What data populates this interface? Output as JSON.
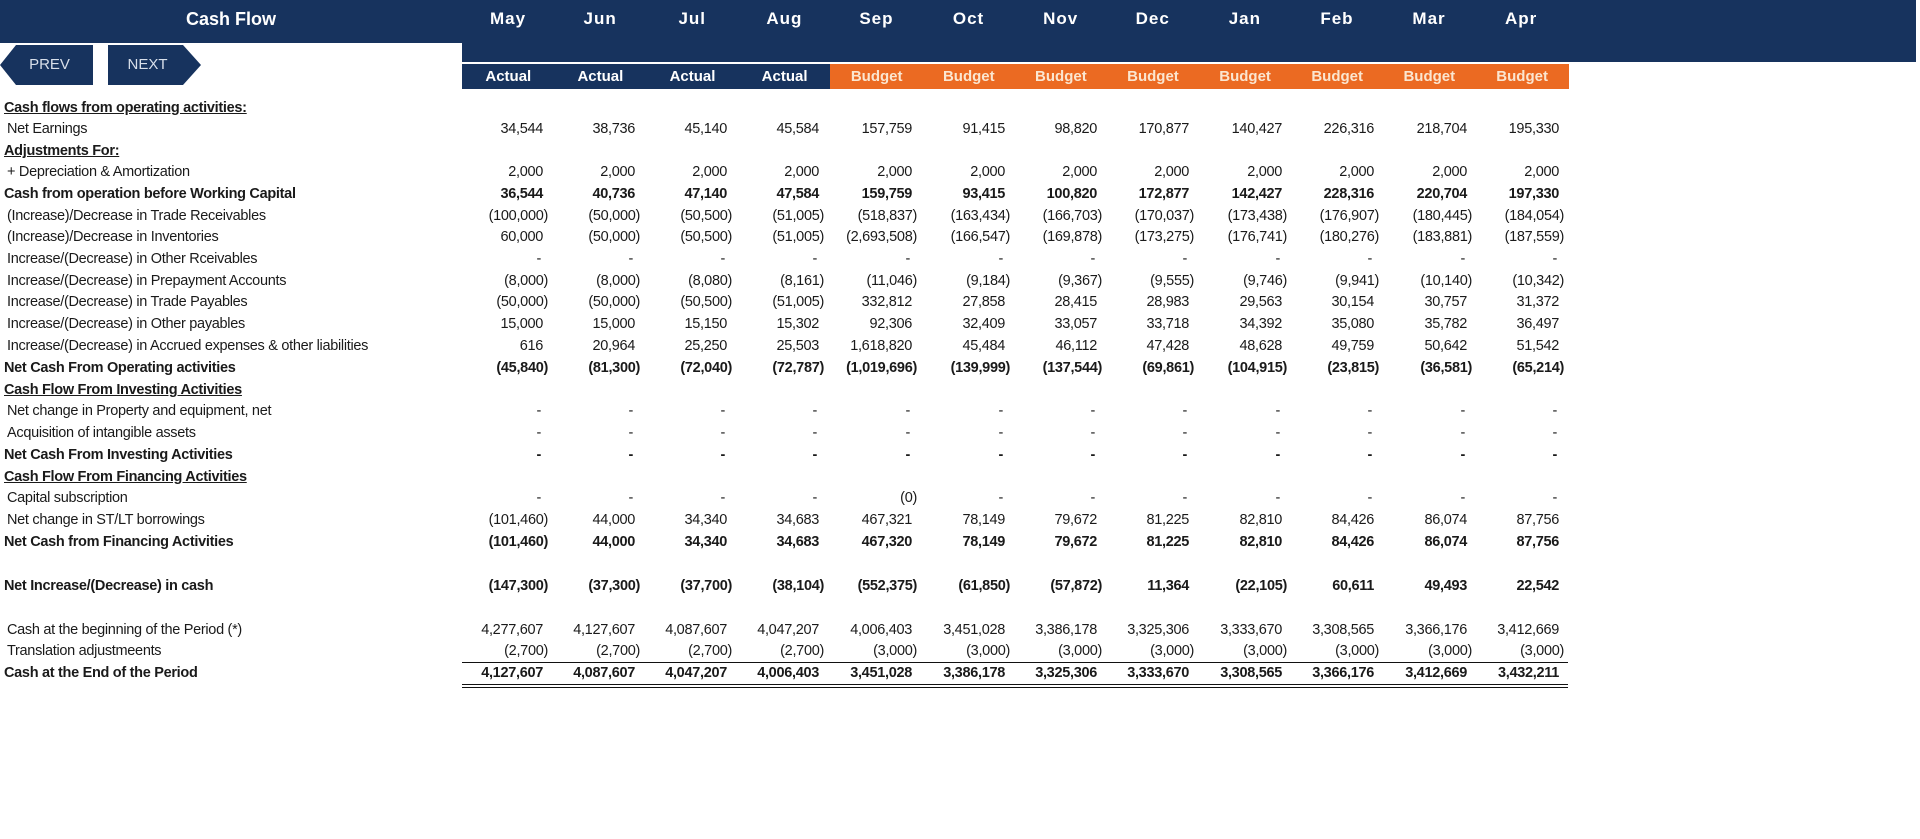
{
  "header": {
    "title": "Cash Flow",
    "prev_label": "PREV",
    "next_label": "NEXT",
    "months": [
      "May",
      "Jun",
      "Jul",
      "Aug",
      "Sep",
      "Oct",
      "Nov",
      "Dec",
      "Jan",
      "Feb",
      "Mar",
      "Apr"
    ],
    "types": [
      "Actual",
      "Actual",
      "Actual",
      "Actual",
      "Budget",
      "Budget",
      "Budget",
      "Budget",
      "Budget",
      "Budget",
      "Budget",
      "Budget"
    ]
  },
  "colors": {
    "navy": "#17335E",
    "budget_orange": "#EB6A22",
    "budget_text": "#FBE6D0"
  },
  "rows": [
    {
      "label": "Cash flows from operating activities:",
      "style": "section",
      "values": []
    },
    {
      "label": "Net Earnings",
      "style": "normal",
      "values": [
        "34,544",
        "38,736",
        "45,140",
        "45,584",
        "157,759",
        "91,415",
        "98,820",
        "170,877",
        "140,427",
        "226,316",
        "218,704",
        "195,330"
      ]
    },
    {
      "label": "Adjustments For:",
      "style": "section",
      "values": []
    },
    {
      "label": "+ Depreciation & Amortization",
      "style": "normal",
      "values": [
        "2,000",
        "2,000",
        "2,000",
        "2,000",
        "2,000",
        "2,000",
        "2,000",
        "2,000",
        "2,000",
        "2,000",
        "2,000",
        "2,000"
      ]
    },
    {
      "label": "Cash from operation before Working Capital",
      "style": "bold",
      "values": [
        "36,544",
        "40,736",
        "47,140",
        "47,584",
        "159,759",
        "93,415",
        "100,820",
        "172,877",
        "142,427",
        "228,316",
        "220,704",
        "197,330"
      ]
    },
    {
      "label": "(Increase)/Decrease in Trade Receivables",
      "style": "normal",
      "values": [
        "(100,000)",
        "(50,000)",
        "(50,500)",
        "(51,005)",
        "(518,837)",
        "(163,434)",
        "(166,703)",
        "(170,037)",
        "(173,438)",
        "(176,907)",
        "(180,445)",
        "(184,054)"
      ]
    },
    {
      "label": "(Increase)/Decrease in Inventories",
      "style": "normal",
      "values": [
        "60,000",
        "(50,000)",
        "(50,500)",
        "(51,005)",
        "(2,693,508)",
        "(166,547)",
        "(169,878)",
        "(173,275)",
        "(176,741)",
        "(180,276)",
        "(183,881)",
        "(187,559)"
      ]
    },
    {
      "label": "Increase/(Decrease) in Other Rceivables",
      "style": "normal",
      "values": [
        "-",
        "-",
        "-",
        "-",
        "-",
        "-",
        "-",
        "-",
        "-",
        "-",
        "-",
        "-"
      ]
    },
    {
      "label": "Increase/(Decrease) in Prepayment Accounts",
      "style": "normal",
      "values": [
        "(8,000)",
        "(8,000)",
        "(8,080)",
        "(8,161)",
        "(11,046)",
        "(9,184)",
        "(9,367)",
        "(9,555)",
        "(9,746)",
        "(9,941)",
        "(10,140)",
        "(10,342)"
      ]
    },
    {
      "label": "Increase/(Decrease) in Trade Payables",
      "style": "normal",
      "values": [
        "(50,000)",
        "(50,000)",
        "(50,500)",
        "(51,005)",
        "332,812",
        "27,858",
        "28,415",
        "28,983",
        "29,563",
        "30,154",
        "30,757",
        "31,372"
      ]
    },
    {
      "label": "Increase/(Decrease) in Other payables",
      "style": "normal",
      "values": [
        "15,000",
        "15,000",
        "15,150",
        "15,302",
        "92,306",
        "32,409",
        "33,057",
        "33,718",
        "34,392",
        "35,080",
        "35,782",
        "36,497"
      ]
    },
    {
      "label": "Increase/(Decrease) in Accrued expenses & other liabilities",
      "style": "normal",
      "values": [
        "616",
        "20,964",
        "25,250",
        "25,503",
        "1,618,820",
        "45,484",
        "46,112",
        "47,428",
        "48,628",
        "49,759",
        "50,642",
        "51,542"
      ]
    },
    {
      "label": "Net Cash From Operating activities",
      "style": "bold",
      "values": [
        "(45,840)",
        "(81,300)",
        "(72,040)",
        "(72,787)",
        "(1,019,696)",
        "(139,999)",
        "(137,544)",
        "(69,861)",
        "(104,915)",
        "(23,815)",
        "(36,581)",
        "(65,214)"
      ]
    },
    {
      "label": "Cash Flow From Investing Activities",
      "style": "section",
      "values": []
    },
    {
      "label": "Net change in Property and equipment, net",
      "style": "normal",
      "values": [
        "-",
        "-",
        "-",
        "-",
        "-",
        "-",
        "-",
        "-",
        "-",
        "-",
        "-",
        "-"
      ]
    },
    {
      "label": "Acquisition of intangible assets",
      "style": "normal",
      "values": [
        "-",
        "-",
        "-",
        "-",
        "-",
        "-",
        "-",
        "-",
        "-",
        "-",
        "-",
        "-"
      ]
    },
    {
      "label": "Net Cash From Investing Activities",
      "style": "bold",
      "values": [
        "-",
        "-",
        "-",
        "-",
        "-",
        "-",
        "-",
        "-",
        "-",
        "-",
        "-",
        "-"
      ]
    },
    {
      "label": "Cash Flow From Financing Activities",
      "style": "section",
      "values": []
    },
    {
      "label": "Capital subscription",
      "style": "normal",
      "values": [
        "-",
        "-",
        "-",
        "-",
        "(0)",
        "-",
        "-",
        "-",
        "-",
        "-",
        "-",
        "-"
      ]
    },
    {
      "label": "Net change in ST/LT borrowings",
      "style": "normal",
      "values": [
        "(101,460)",
        "44,000",
        "34,340",
        "34,683",
        "467,321",
        "78,149",
        "79,672",
        "81,225",
        "82,810",
        "84,426",
        "86,074",
        "87,756"
      ]
    },
    {
      "label": "Net Cash from Financing Activities",
      "style": "bold",
      "values": [
        "(101,460)",
        "44,000",
        "34,340",
        "34,683",
        "467,320",
        "78,149",
        "79,672",
        "81,225",
        "82,810",
        "84,426",
        "86,074",
        "87,756"
      ]
    },
    {
      "label": "Net Increase/(Decrease) in cash",
      "style": "bold",
      "values": [
        "(147,300)",
        "(37,300)",
        "(37,700)",
        "(38,104)",
        "(552,375)",
        "(61,850)",
        "(57,872)",
        "11,364",
        "(22,105)",
        "60,611",
        "49,493",
        "22,542"
      ]
    },
    {
      "label": "Cash at the beginning of the Period (*)",
      "style": "normal",
      "values": [
        "4,277,607",
        "4,127,607",
        "4,087,607",
        "4,047,207",
        "4,006,403",
        "3,451,028",
        "3,386,178",
        "3,325,306",
        "3,333,670",
        "3,308,565",
        "3,366,176",
        "3,412,669"
      ]
    },
    {
      "label": "Translation adjustmeents",
      "style": "normal",
      "values": [
        "(2,700)",
        "(2,700)",
        "(2,700)",
        "(2,700)",
        "(3,000)",
        "(3,000)",
        "(3,000)",
        "(3,000)",
        "(3,000)",
        "(3,000)",
        "(3,000)",
        "(3,000)"
      ]
    },
    {
      "label": "Cash at the End of the Period",
      "style": "bold",
      "values": [
        "4,127,607",
        "4,087,607",
        "4,047,207",
        "4,006,403",
        "3,451,028",
        "3,386,178",
        "3,325,306",
        "3,333,670",
        "3,308,565",
        "3,366,176",
        "3,412,669",
        "3,432,211"
      ]
    }
  ]
}
